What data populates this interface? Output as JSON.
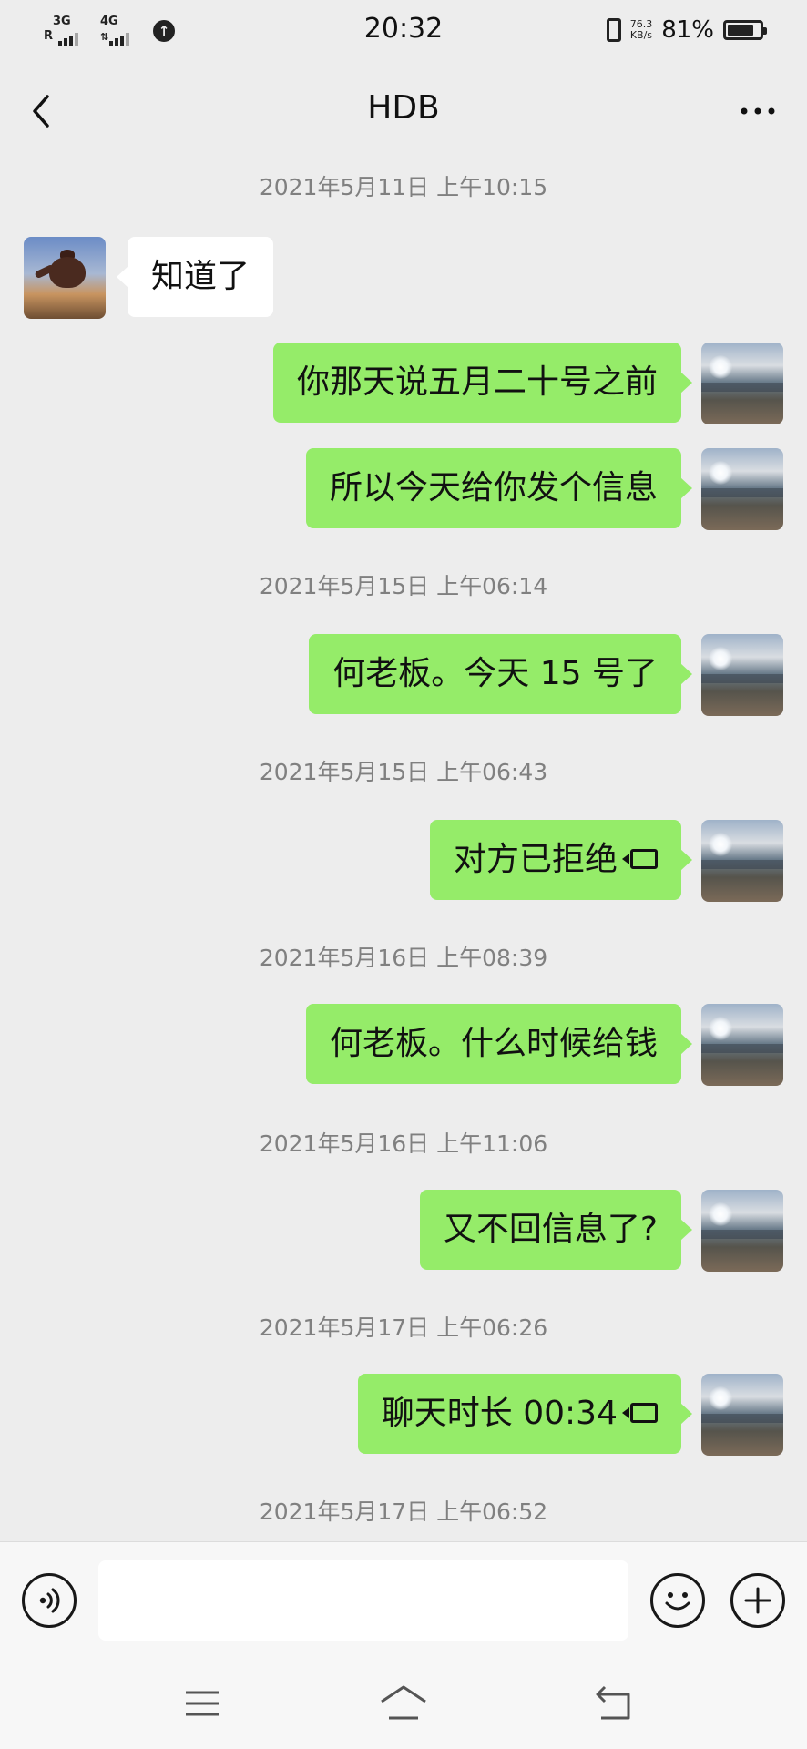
{
  "status_bar": {
    "net1": "3G",
    "roaming": "R",
    "net2": "4G",
    "time": "20:32",
    "speed_value": "76.3",
    "speed_unit": "KB/s",
    "battery_percent": "81%",
    "battery_level": 0.81
  },
  "header": {
    "title": "HDB",
    "back_icon": "chevron-left-icon",
    "more_icon": "more-horizontal-icon"
  },
  "chat": {
    "stamps": [
      "2021年5月11日 上午10:15",
      "2021年5月15日 上午06:14",
      "2021年5月15日 上午06:43",
      "2021年5月16日 上午08:39",
      "2021年5月16日 上午11:06",
      "2021年5月17日 上午06:26",
      "2021年5月17日 上午06:52"
    ],
    "messages": [
      {
        "from": "them",
        "text": "知道了"
      },
      {
        "from": "me",
        "text": "你那天说五月二十号之前"
      },
      {
        "from": "me",
        "text": "所以今天给你发个信息"
      },
      {
        "from": "me",
        "text": "何老板。今天 15 号了"
      },
      {
        "from": "me",
        "text": "对方已拒绝",
        "icon": "video-call-icon"
      },
      {
        "from": "me",
        "text": "何老板。什么时候给钱"
      },
      {
        "from": "me",
        "text": "又不回信息了?"
      },
      {
        "from": "me",
        "text": "聊天时长 00:34",
        "icon": "video-call-icon"
      }
    ]
  },
  "input_bar": {
    "voice_icon": "voice-icon",
    "input_value": "",
    "emoji_icon": "emoji-icon",
    "plus_icon": "plus-icon"
  },
  "nav_bar": {
    "menu_icon": "menu-icon",
    "home_icon": "home-icon",
    "back_icon": "back-icon"
  },
  "colors": {
    "background": "#ededed",
    "my_bubble": "#95ec69",
    "their_bubble": "#ffffff",
    "timestamp": "#808080"
  }
}
